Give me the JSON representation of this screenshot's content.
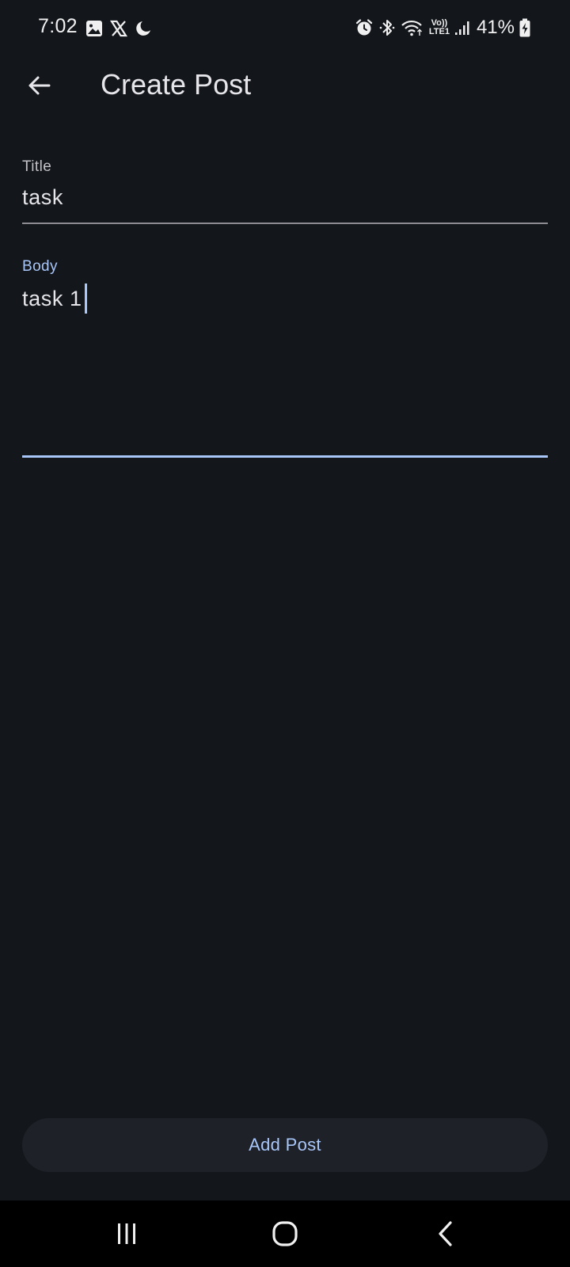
{
  "status_bar": {
    "time": "7:02",
    "left_icons": [
      "gallery-icon",
      "x-logo-icon",
      "do-not-disturb-icon"
    ],
    "right_icons": [
      "alarm-icon",
      "bluetooth-icon",
      "wifi-icon",
      "volte-icon",
      "signal-icon",
      "battery-charging-icon"
    ],
    "volte_top": "Vo))",
    "volte_bottom": "LTE1",
    "battery_percent": "41%"
  },
  "app_bar": {
    "title": "Create Post",
    "back_icon": "arrow-back-icon"
  },
  "form": {
    "title_field": {
      "label": "Title",
      "value": "task"
    },
    "body_field": {
      "label": "Body",
      "value": "task 1",
      "focused": true
    }
  },
  "actions": {
    "add_post_label": "Add Post"
  },
  "nav_bar": {
    "recents_icon": "recents-icon",
    "home_icon": "home-icon",
    "back_icon": "nav-back-icon"
  },
  "colors": {
    "background": "#13161b",
    "accent": "#a8c6f8",
    "button_bg": "#1e2127",
    "nav_bg": "#000000"
  }
}
